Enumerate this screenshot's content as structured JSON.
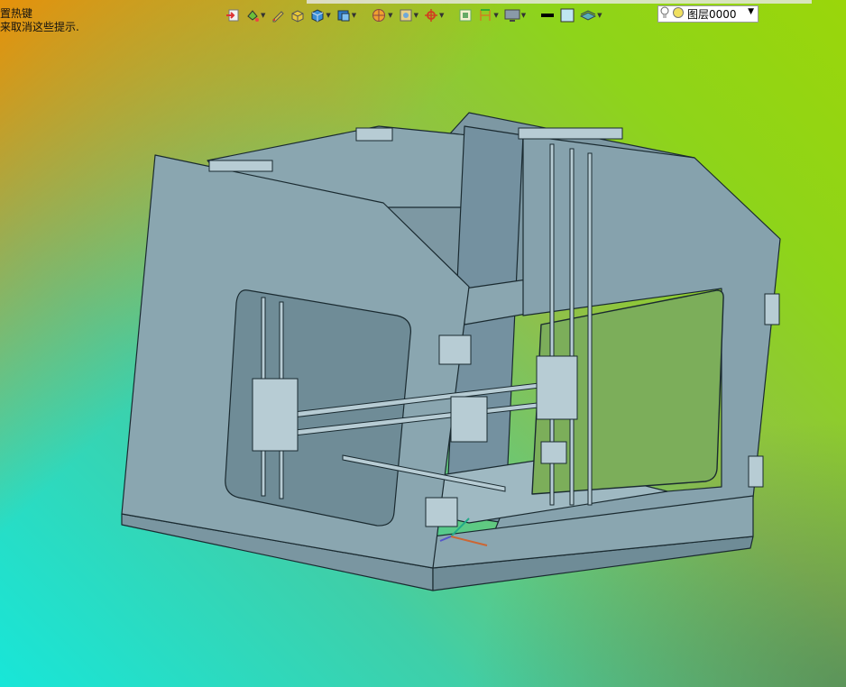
{
  "hint": {
    "line1": "置热键",
    "line2": "来取消这些提示."
  },
  "toolbar": {
    "layer_label": "图层0000",
    "icons": [
      "exit-icon",
      "paint-bucket-icon",
      "pen-icon",
      "box-yellow-icon",
      "cube-icon",
      "view-cube-icon",
      "render-sphere-icon",
      "image-icon",
      "crosshair-icon",
      "frame-icon",
      "dimension-icon",
      "monitor-icon",
      "black-line-icon",
      "color-swatch-icon",
      "layers-icon",
      "lightbulb-icon",
      "sun-icon"
    ]
  },
  "colors": {
    "panel": "#8aa6b0",
    "panel_dark": "#6f8c97",
    "outline": "#1a2a30",
    "swatch": "#bfe6f2"
  }
}
